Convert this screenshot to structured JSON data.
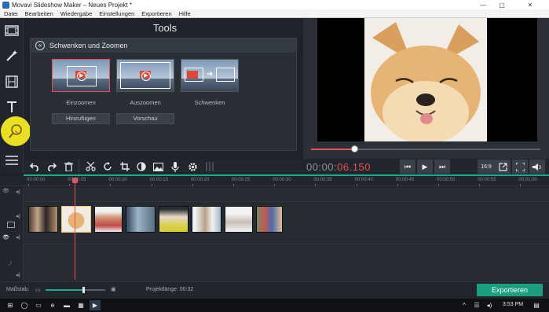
{
  "window": {
    "title": "Movavi Slideshow Maker – Neues Projekt *"
  },
  "menu": [
    "Datei",
    "Bearbeiten",
    "Wiedergabe",
    "Einstellungen",
    "Exportieren",
    "Hilfe"
  ],
  "tools": {
    "title": "Tools",
    "panel_title": "Schwenken und Zoomen",
    "effects": [
      {
        "label": "Einzoomen",
        "selected": true
      },
      {
        "label": "Auszoomen",
        "selected": false
      },
      {
        "label": "Schwenken",
        "selected": false
      }
    ],
    "add_button": "Hinzufügen",
    "preview_button": "Vorschau"
  },
  "player": {
    "timecode_dim": "00:00:",
    "timecode_active": "06.150",
    "seek_progress": 0.19,
    "aspect_label": "16:9"
  },
  "timeline": {
    "ruler": [
      "00:00:00",
      "00:00:05",
      "00:00:10",
      "00:00:15",
      "00:00:20",
      "00:00:25",
      "00:00:30",
      "00:00:35",
      "00:00:40",
      "00:00:45",
      "00:00:50",
      "00:00:55",
      "00:01:00"
    ]
  },
  "footer": {
    "scale_label": "Maßstab:",
    "zoom_level": 0.62,
    "project_length_label": "Projektlänge: 00:32",
    "export_label": "Exportieren"
  },
  "taskbar": {
    "time": "3:53 PM"
  },
  "colors": {
    "accent": "#18ad8f",
    "playhead": "#e8505b",
    "highlight": "#e8e021"
  }
}
